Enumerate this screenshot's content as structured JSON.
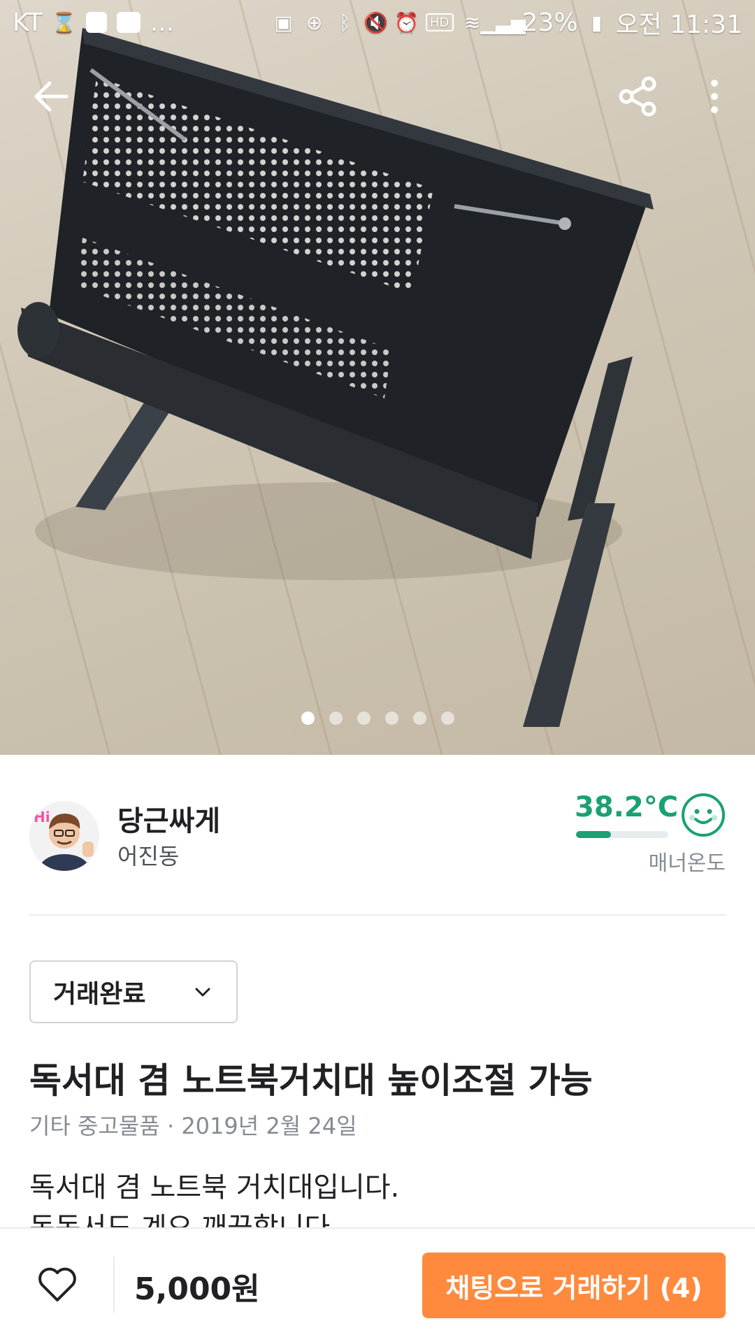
{
  "status_bar": {
    "carrier": "KT",
    "overflow": "...",
    "battery_percent": "23%",
    "time": "오전 11:31",
    "icons": [
      "hourglass-icon",
      "b-app-icon",
      "mall-app-icon",
      "battery-saver-icon",
      "data-saver-icon",
      "bluetooth-icon",
      "mute-icon",
      "alarm-icon",
      "hd-icon",
      "wifi-icon",
      "signal-icon",
      "battery-icon"
    ]
  },
  "toolbar": {
    "back_icon": "back-arrow-icon",
    "share_icon": "share-icon",
    "more_icon": "more-vertical-icon"
  },
  "gallery": {
    "image_count": 6,
    "active_index": 0
  },
  "seller": {
    "name": "당근싸게",
    "location": "어진동",
    "manner_temp": "38.2°C",
    "manner_temp_level": 0.38,
    "manner_label": "매너온도",
    "manner_face_icon": "smile-face-icon"
  },
  "status_select": {
    "selected": "거래완료"
  },
  "post": {
    "title": "독서대 겸 노트북거치대 높이조절 가능",
    "category_date": "기타 중고물품 · 2019년 2월 24일",
    "description_line1": "독서대 겸 노트북 거치대입니다.",
    "description_line2": "독독서도 계요 깨끗합니다"
  },
  "bottom_bar": {
    "price": "5,000원",
    "chat_button": "채팅으로 거래하기 (4)",
    "like_icon": "heart-icon"
  },
  "colors": {
    "accent": "#ff8a3d",
    "manner_green": "#1aa174",
    "text_primary": "#212124",
    "text_secondary": "#868b94"
  }
}
